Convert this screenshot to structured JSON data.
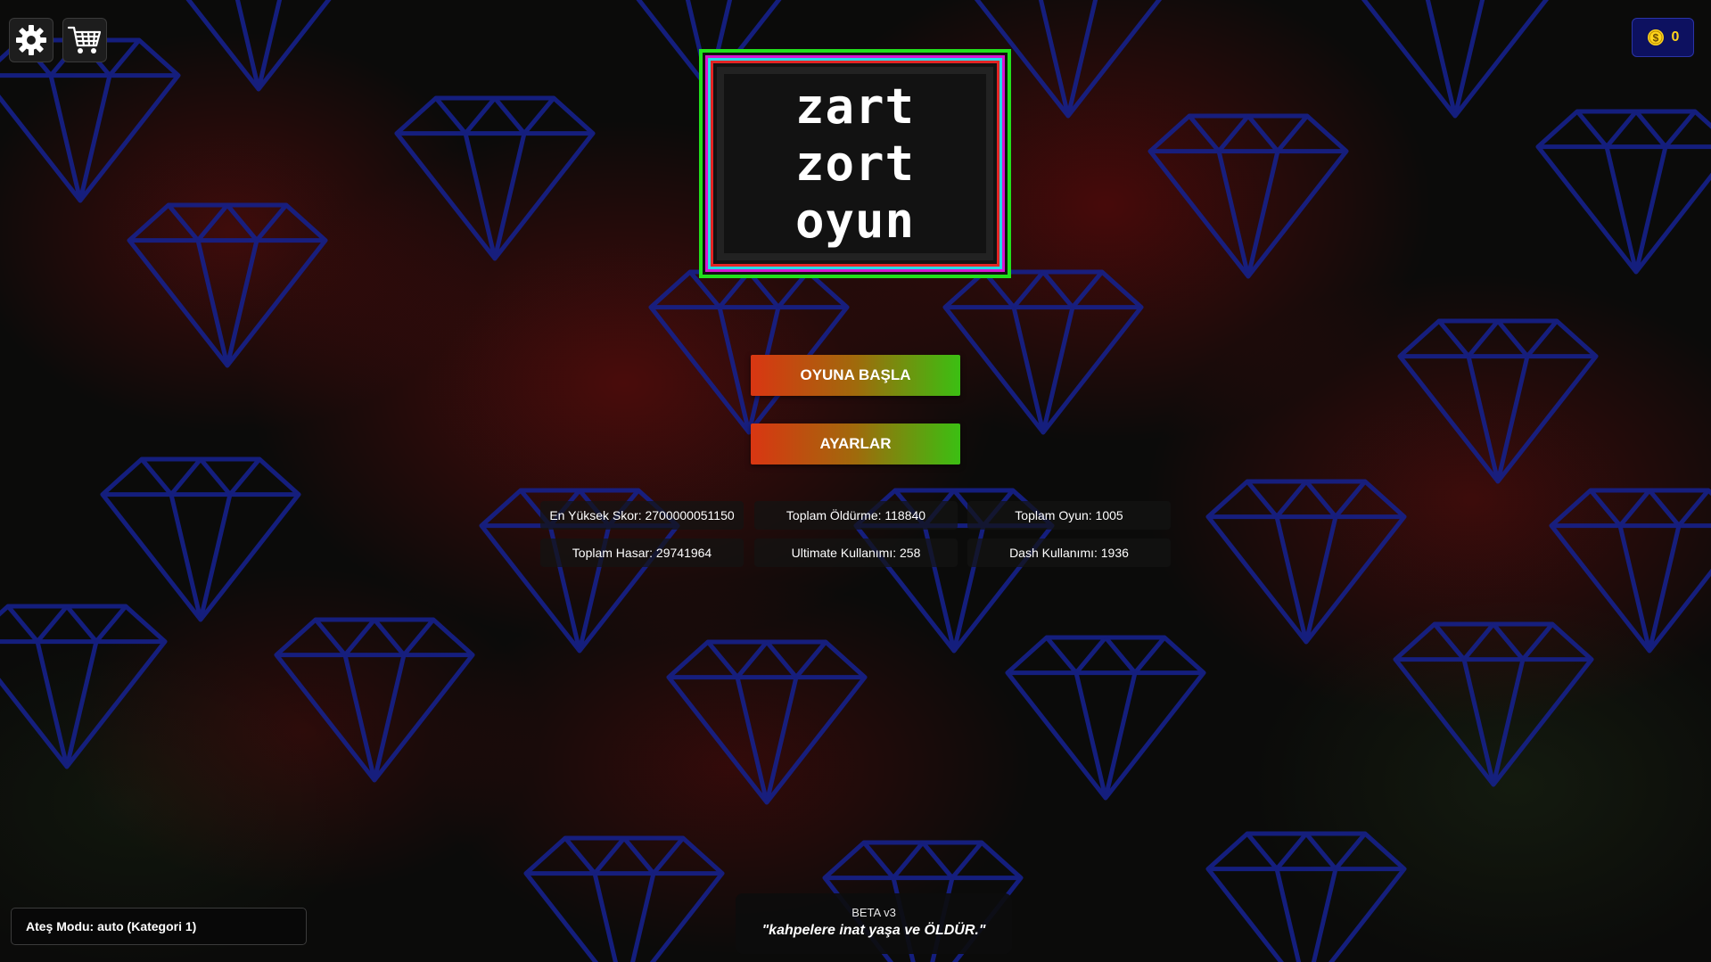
{
  "colors": {
    "diamond_outline": "#16218a",
    "blood_red": "#7c0a0a",
    "coin_gold": "#ffd51c",
    "coin_box_bg": "#0d1160",
    "button_gradient": [
      "#d93612",
      "#3bbf12"
    ],
    "logo_border_green": "#22e01c",
    "logo_border_magenta": "#d714d0",
    "logo_border_cyan": "#25d9e6",
    "logo_border_red": "#e22525"
  },
  "top_bar": {
    "settings_icon": "gear-icon",
    "shop_icon": "shopping-cart-icon",
    "coin_icon": "dollar-coin-icon",
    "coins": "0"
  },
  "logo": {
    "title_line1": "zart zort",
    "title_line2": "oyun"
  },
  "menu": {
    "start_label": "OYUNA BAŞLA",
    "settings_label": "AYARLAR"
  },
  "stats": [
    {
      "label": "En Yüksek Skor: 2700000051150"
    },
    {
      "label": "Toplam Öldürme: 118840"
    },
    {
      "label": "Toplam Oyun: 1005"
    },
    {
      "label": "Toplam Hasar: 29741964"
    },
    {
      "label": "Ultimate Kullanımı: 258"
    },
    {
      "label": "Dash Kullanımı: 1936"
    }
  ],
  "fire_mode": {
    "label": "Ateş Modu: auto (Kategori 1)"
  },
  "footer": {
    "version": "BETA v3",
    "quote": "\"kahpelere inat yaşa ve ÖLDÜR.\""
  }
}
